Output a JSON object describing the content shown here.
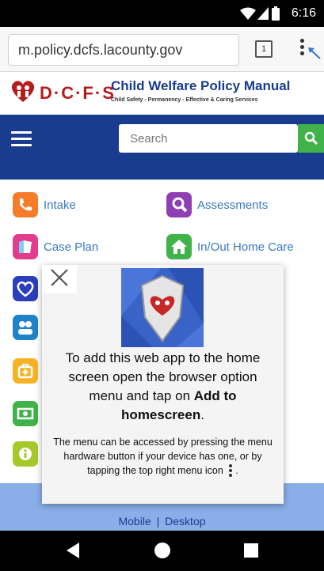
{
  "status_bar": {
    "time": "6:16"
  },
  "browser": {
    "url": "m.policy.dcfs.lacounty.gov",
    "tab_count": "1"
  },
  "header": {
    "logo_text": "D·C·F·S",
    "title": "Child Welfare Policy Manual",
    "tagline": "Child Safety - Permanency - Effective & Caring Services"
  },
  "search": {
    "placeholder": "Search"
  },
  "menu": {
    "items": [
      {
        "label": "Intake",
        "color": "#f57c2a"
      },
      {
        "label": "Assessments",
        "color": "#8e3fb4"
      },
      {
        "label": "Case Plan",
        "color": "#e23c8c"
      },
      {
        "label": "In/Out Home Care",
        "color": "#3fb24a"
      }
    ],
    "side_icons": [
      {
        "icon": "heart-icon",
        "color": "#2a3fb8"
      },
      {
        "icon": "people-icon",
        "color": "#1f83c9"
      },
      {
        "icon": "medical-kit-icon",
        "color": "#f5b324"
      },
      {
        "icon": "money-icon",
        "color": "#3fb24a"
      },
      {
        "icon": "info-icon",
        "color": "#a6c92a"
      }
    ]
  },
  "modal": {
    "message_start": "To add this web app to the home screen open the browser option menu and tap on ",
    "message_bold": "Add to homescreen",
    "message_end": ".",
    "sub_message": "The menu can be accessed by pressing the menu hardware button if your device has one, or by tapping the top right menu icon",
    "sub_message_end": "."
  },
  "footer": {
    "mobile_link": "Mobile",
    "separator": "|",
    "desktop_link": "Desktop"
  }
}
